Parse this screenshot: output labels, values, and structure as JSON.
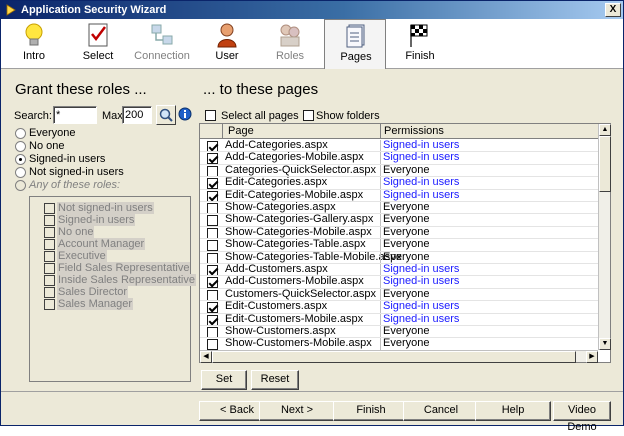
{
  "window": {
    "title": "Application Security Wizard",
    "close_label": "X"
  },
  "steps": [
    {
      "label": "Intro",
      "icon": "lightbulb-icon",
      "state": "normal"
    },
    {
      "label": "Select",
      "icon": "checklist-icon",
      "state": "normal"
    },
    {
      "label": "Connection",
      "icon": "network-icon",
      "state": "disabled"
    },
    {
      "label": "User",
      "icon": "user-icon",
      "state": "normal"
    },
    {
      "label": "Roles",
      "icon": "roles-icon",
      "state": "disabled"
    },
    {
      "label": "Pages",
      "icon": "pages-icon",
      "state": "active"
    },
    {
      "label": "Finish",
      "icon": "checkered-flag-icon",
      "state": "normal"
    }
  ],
  "left": {
    "heading": "Grant these roles ...",
    "search_label": "Search:",
    "search_value": "*",
    "max_label": "Max:",
    "max_value": "200",
    "options": [
      {
        "label": "Everyone",
        "checked": false,
        "disabled": false
      },
      {
        "label": "No one",
        "checked": false,
        "disabled": false
      },
      {
        "label": "Signed-in users",
        "checked": true,
        "disabled": false
      },
      {
        "label": "Not signed-in users",
        "checked": false,
        "disabled": false
      },
      {
        "label": "Any of these roles:",
        "checked": false,
        "disabled": true
      }
    ],
    "roles": [
      "Not signed-in users",
      "Signed-in users",
      "No one",
      "Account Manager",
      "Executive",
      "Field Sales Representative",
      "Inside Sales Representative",
      "Sales Director",
      "Sales Manager"
    ]
  },
  "right": {
    "heading": "... to these pages",
    "select_all_label": "Select all pages",
    "show_folders_label": "Show folders",
    "columns": {
      "page": "Page",
      "permissions": "Permissions"
    },
    "rows": [
      {
        "page": "Add-Categories.aspx",
        "perm": "Signed-in users",
        "checked": true
      },
      {
        "page": "Add-Categories-Mobile.aspx",
        "perm": "Signed-in users",
        "checked": true
      },
      {
        "page": "Categories-QuickSelector.aspx",
        "perm": "Everyone",
        "checked": false
      },
      {
        "page": "Edit-Categories.aspx",
        "perm": "Signed-in users",
        "checked": true
      },
      {
        "page": "Edit-Categories-Mobile.aspx",
        "perm": "Signed-in users",
        "checked": true
      },
      {
        "page": "Show-Categories.aspx",
        "perm": "Everyone",
        "checked": false
      },
      {
        "page": "Show-Categories-Gallery.aspx",
        "perm": "Everyone",
        "checked": false
      },
      {
        "page": "Show-Categories-Mobile.aspx",
        "perm": "Everyone",
        "checked": false
      },
      {
        "page": "Show-Categories-Table.aspx",
        "perm": "Everyone",
        "checked": false
      },
      {
        "page": "Show-Categories-Table-Mobile.aspx",
        "perm": "Everyone",
        "checked": false
      },
      {
        "page": "Add-Customers.aspx",
        "perm": "Signed-in users",
        "checked": true
      },
      {
        "page": "Add-Customers-Mobile.aspx",
        "perm": "Signed-in users",
        "checked": true
      },
      {
        "page": "Customers-QuickSelector.aspx",
        "perm": "Everyone",
        "checked": false
      },
      {
        "page": "Edit-Customers.aspx",
        "perm": "Signed-in users",
        "checked": true
      },
      {
        "page": "Edit-Customers-Mobile.aspx",
        "perm": "Signed-in users",
        "checked": true
      },
      {
        "page": "Show-Customers.aspx",
        "perm": "Everyone",
        "checked": false
      },
      {
        "page": "Show-Customers-Mobile.aspx",
        "perm": "Everyone",
        "checked": false
      }
    ],
    "set_label": "Set",
    "reset_label": "Reset"
  },
  "footer": {
    "back": "< Back",
    "next": "Next >",
    "finish": "Finish",
    "cancel": "Cancel",
    "help": "Help",
    "video_demo": "Video Demo"
  },
  "colors": {
    "link_blue": "#1a1aff",
    "title_bar": "#0a246a"
  }
}
